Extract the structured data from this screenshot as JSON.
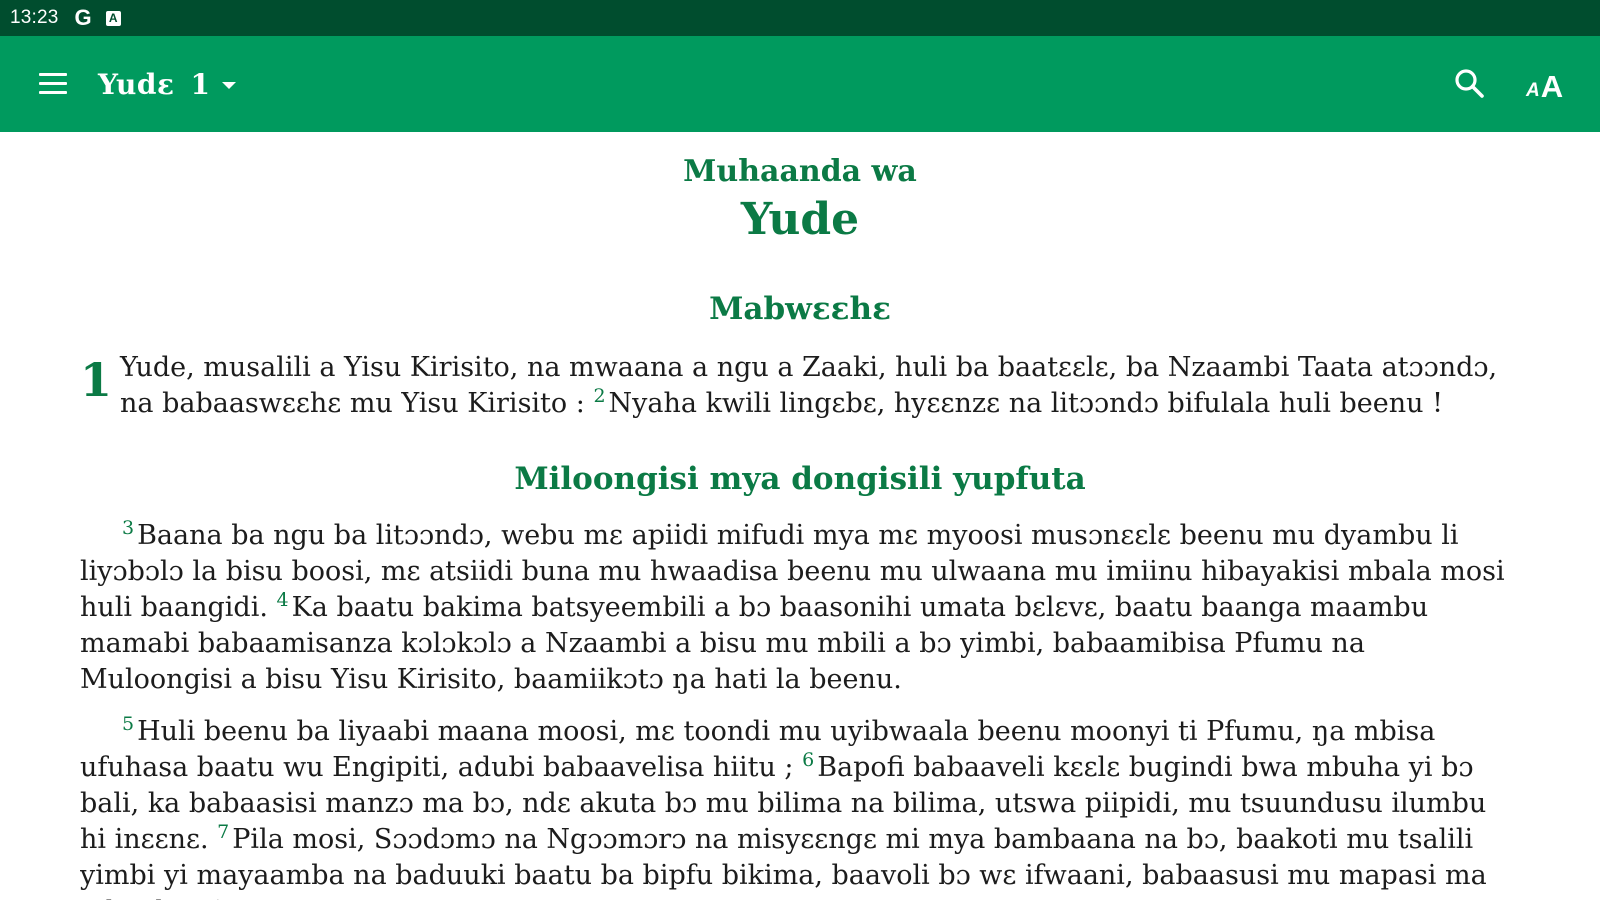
{
  "status_bar": {
    "time": "13:23",
    "g_icon": "G",
    "a_icon": "A"
  },
  "app_bar": {
    "book": "Yudɛ",
    "chapter": "1",
    "icons": [
      "menu-icon",
      "caret-down-icon",
      "search-icon",
      "font-size-icon"
    ],
    "font_small": "A",
    "font_big": "A"
  },
  "colors": {
    "status_bar": "#004d2e",
    "app_bar": "#009a5e",
    "heading": "#0b7a45"
  },
  "content": {
    "intro": "Muhaanda wa",
    "book_title": "Yude",
    "heading1": "Mabwɛɛhɛ",
    "chapter_num": "1",
    "v1": "Yude, musalili a Yisu Kirisito, na mwaana a ngu a Zaaki, huli ba baatɛɛlɛ, ba Nzaambi Taata atɔɔndɔ, na babaaswɛɛhɛ mu Yisu Kirisito :",
    "v2_num": "2",
    "v2": "Nyaha kwili lingɛbɛ, hyɛɛnzɛ na litɔɔndɔ bifulala huli beenu !",
    "heading2": "Miloongisi mya dongisili yupfuta",
    "v3_num": "3",
    "v3": "Baana ba ngu ba litɔɔndɔ, webu mɛ apiidi mifudi mya mɛ myoosi musɔnɛɛlɛ beenu mu dyambu li liyɔbɔlɔ la bisu boosi, mɛ atsiidi buna mu hwaadisa beenu mu ulwaana mu imiinu hibayakisi mbala mosi huli baangidi.",
    "v4_num": "4",
    "v4": "Ka baatu bakima batsyeembili a bɔ baasonihi umata bɛlɛvɛ, baatu baanga maambu mamabi babaamisanza kɔlɔkɔlɔ a Nzaambi a bisu mu mbili a bɔ yimbi, babaamibisa Pfumu na Muloongisi a bisu Yisu Kirisito, baamiikɔtɔ ŋa hati la beenu.",
    "v5_num": "5",
    "v5": "Huli beenu ba liyaabi maana moosi, mɛ toondi mu uyibwaala beenu moonyi ti Pfumu, ŋa mbisa ufuhasa baatu wu Engipiti, adubi babaavelisa hiitu ;",
    "v6_num": "6",
    "v6": "Bapofi babaaveli kɛɛlɛ bugindi bwa mbuha yi bɔ bali, ka babaasisi manzɔ ma bɔ, ndɛ akuta bɔ mu bilima na bilima, utswa piipidi, mu tsuundusu ilumbu hi inɛɛnɛ.",
    "v7_num": "7",
    "v7": "Pila mosi, Sɔɔdɔmɔ na Ngɔɔmɔrɔ na misyɛɛngɛ mi mya bambaana na bɔ, baakoti mu tsalili yimbi yi mayaamba na baduuki baatu ba bipfu bikima, baavoli bɔ wɛ ifwaani, babaasusi mu mapasi ma mbaahu yi"
  }
}
